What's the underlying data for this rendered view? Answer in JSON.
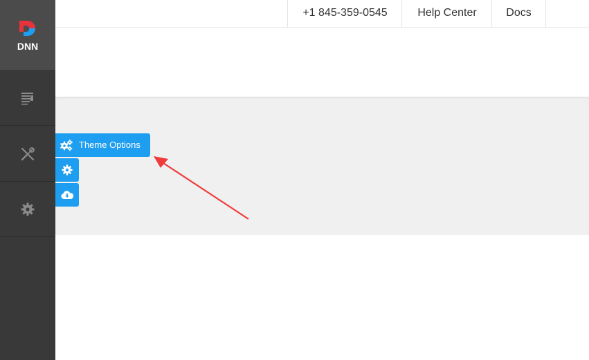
{
  "sidebar": {
    "logo_text": "DNN",
    "items": [
      {
        "icon": "content-icon"
      },
      {
        "icon": "tools-icon"
      },
      {
        "icon": "gear-icon"
      }
    ]
  },
  "topbar": {
    "phone": "+1 845-359-0545",
    "help_center": "Help Center",
    "docs": "Docs"
  },
  "theme_panel": {
    "theme_options_label": "Theme Options",
    "buttons": [
      {
        "icon": "cogs-icon"
      },
      {
        "icon": "cog-icon"
      },
      {
        "icon": "cloud-download-icon"
      }
    ]
  },
  "colors": {
    "accent": "#1e9ef0",
    "sidebar": "#3a3939",
    "logo_bg": "#4c4b4b",
    "annotation_arrow": "#ef3b3b"
  }
}
